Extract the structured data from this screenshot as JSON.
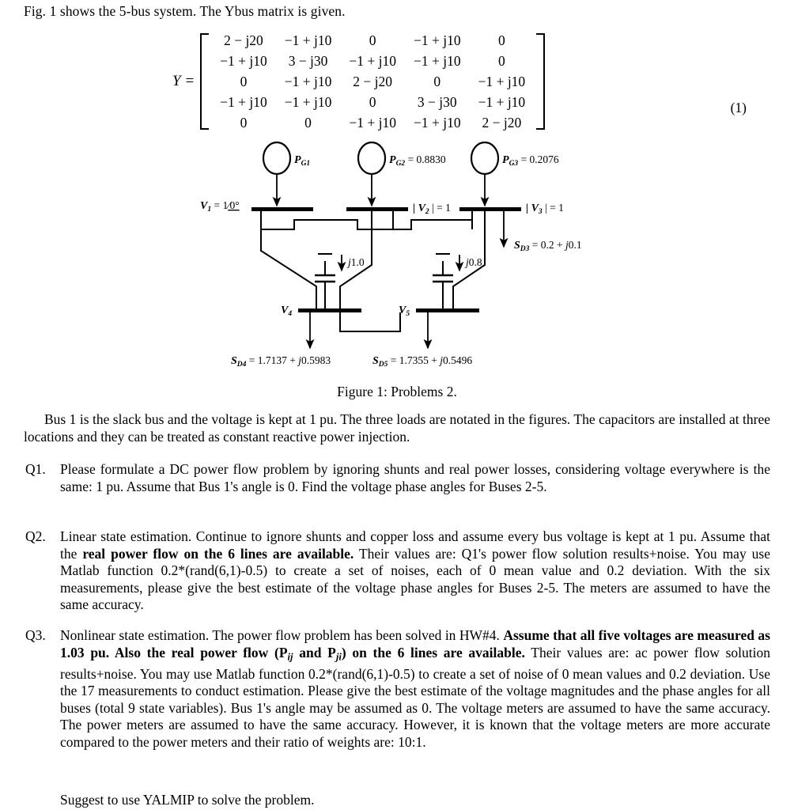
{
  "document": {
    "intro_line": "Fig. 1 shows the 5-bus system. The Ybus matrix is given.",
    "equation": {
      "lhs": "Y =",
      "number": "(1)",
      "matrix": [
        [
          "2 − j20",
          "−1 + j10",
          "0",
          "−1 + j10",
          "0"
        ],
        [
          "−1 + j10",
          "3 − j30",
          "−1 + j10",
          "−1 + j10",
          "0"
        ],
        [
          "0",
          "−1 + j10",
          "2 − j20",
          "0",
          "−1 + j10"
        ],
        [
          "−1 + j10",
          "−1 + j10",
          "0",
          "3 − j30",
          "−1 + j10"
        ],
        [
          "0",
          "0",
          "−1 + j10",
          "−1 + j10",
          "2 − j20"
        ]
      ]
    },
    "figure": {
      "caption": "Figure 1: Problems 2.",
      "generators": [
        {
          "id": "g1",
          "label": "P",
          "sub": "G1",
          "value": ""
        },
        {
          "id": "g2",
          "label": "P",
          "sub": "G2",
          "value": " = 0.8830"
        },
        {
          "id": "g3",
          "label": "P",
          "sub": "G3",
          "value": " = 0.2076"
        }
      ],
      "bus_labels": [
        {
          "id": "bus1",
          "text": "V",
          "sub": "1",
          "value": " = 1/0°"
        },
        {
          "id": "bus2",
          "text": "| V",
          "sub": "2",
          "value": " | = 1"
        },
        {
          "id": "bus3",
          "text": "| V",
          "sub": "3",
          "value": " | = 1"
        },
        {
          "id": "bus4",
          "text": "V",
          "sub": "4",
          "value": ""
        },
        {
          "id": "bus5",
          "text": "V",
          "sub": "5",
          "value": ""
        }
      ],
      "loads": [
        {
          "id": "sd3",
          "text": "S",
          "sub": "D3",
          "value": " = 0.2 + j0.1"
        },
        {
          "id": "sd4",
          "text": "S",
          "sub": "D4",
          "value": " = 1.7137 + j0.5983"
        },
        {
          "id": "sd5",
          "text": "S",
          "sub": "D5",
          "value": " = 1.7355 + j0.5496"
        }
      ],
      "capacitors": [
        {
          "id": "cap4",
          "value": "j1.0"
        },
        {
          "id": "cap5",
          "value": "j0.8"
        }
      ]
    },
    "intro_paragraph": "Bus 1 is the slack bus and the voltage is kept at 1 pu. The three loads are notated in the figures. The capacitors are installed at three locations and they can be treated as constant reactive power injection.",
    "questions": [
      {
        "label": "Q1.",
        "text": "Please formulate a DC power flow problem by ignoring shunts and real power losses, considering voltage everywhere is the same: 1 pu. Assume that Bus 1's angle is 0. Find the voltage phase angles for Buses 2-5."
      },
      {
        "label": "Q2.",
        "text_parts": {
          "p1": "Linear state estimation. Continue to ignore shunts and copper loss and assume every bus voltage is kept at 1 pu. Assume that the ",
          "bold1": "real power flow on the 6 lines are available.",
          "p2": " Their values are: Q1's power flow solution results+noise. You may use Matlab function 0.2*(rand(6,1)-0.5) to create a set of noises, each of 0 mean value and 0.2 deviation. With the six measurements, please give the best estimate of the voltage phase angles for Buses 2-5. The meters are assumed to have the same accuracy."
        }
      },
      {
        "label": "Q3.",
        "text_parts": {
          "p1": "Nonlinear state estimation. The power flow problem has been solved in HW#4. ",
          "bold1": "Assume that all five voltages are measured as 1.03 pu. Also the real power flow (P",
          "bold1_sub1": "ij",
          "bold1_mid": " and P",
          "bold1_sub2": "ji",
          "bold1_end": ") on the 6 lines are available.",
          "p2": " Their values are: ac power flow solution results+noise. You may use Matlab function 0.2*(rand(6,1)-0.5) to create a set of noise of 0 mean values and 0.2 deviation. Use the 17 measurements to conduct estimation. Please give the best estimate of the voltage magnitudes and the phase angles for all buses (total 9 state variables). Bus 1's angle may be assumed as 0. The voltage meters are assumed to have the same accuracy. The power meters are assumed to have the same accuracy. However, it is known that the voltage meters are more accurate compared to the power meters and their ratio of weights are: 10:1."
        }
      }
    ],
    "closing_line": "Suggest to use YALMIP to solve the problem."
  }
}
